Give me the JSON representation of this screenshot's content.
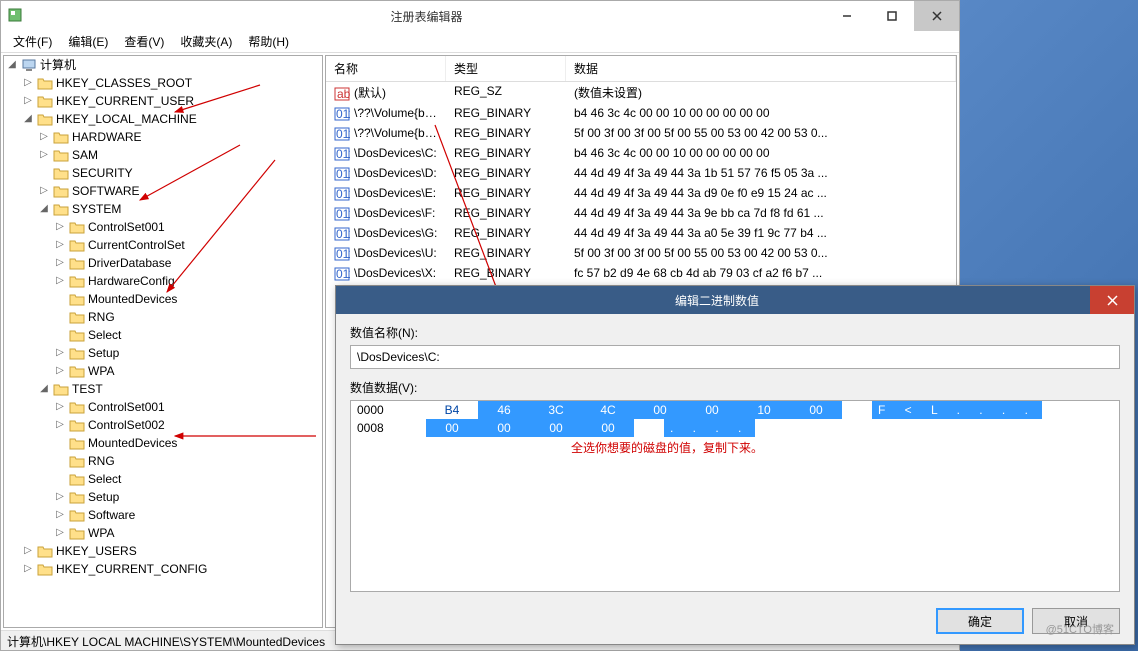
{
  "window": {
    "title": "注册表编辑器",
    "menus": [
      "文件(F)",
      "编辑(E)",
      "查看(V)",
      "收藏夹(A)",
      "帮助(H)"
    ],
    "status": "计算机\\HKEY LOCAL MACHINE\\SYSTEM\\MountedDevices"
  },
  "tree": {
    "root": "计算机",
    "hives": [
      {
        "name": "HKEY_CLASSES_ROOT",
        "exp": "▷"
      },
      {
        "name": "HKEY_CURRENT_USER",
        "exp": "▷"
      },
      {
        "name": "HKEY_LOCAL_MACHINE",
        "exp": "◢",
        "children": [
          {
            "name": "HARDWARE",
            "exp": "▷"
          },
          {
            "name": "SAM",
            "exp": "▷"
          },
          {
            "name": "SECURITY",
            "exp": ""
          },
          {
            "name": "SOFTWARE",
            "exp": "▷"
          },
          {
            "name": "SYSTEM",
            "exp": "◢",
            "children": [
              {
                "name": "ControlSet001",
                "exp": "▷"
              },
              {
                "name": "CurrentControlSet",
                "exp": "▷"
              },
              {
                "name": "DriverDatabase",
                "exp": "▷"
              },
              {
                "name": "HardwareConfig",
                "exp": "▷"
              },
              {
                "name": "MountedDevices",
                "exp": ""
              },
              {
                "name": "RNG",
                "exp": ""
              },
              {
                "name": "Select",
                "exp": ""
              },
              {
                "name": "Setup",
                "exp": "▷"
              },
              {
                "name": "WPA",
                "exp": "▷"
              }
            ]
          },
          {
            "name": "TEST",
            "exp": "◢",
            "children": [
              {
                "name": "ControlSet001",
                "exp": "▷"
              },
              {
                "name": "ControlSet002",
                "exp": "▷"
              },
              {
                "name": "MountedDevices",
                "exp": ""
              },
              {
                "name": "RNG",
                "exp": ""
              },
              {
                "name": "Select",
                "exp": ""
              },
              {
                "name": "Setup",
                "exp": "▷"
              },
              {
                "name": "Software",
                "exp": "▷"
              },
              {
                "name": "WPA",
                "exp": "▷"
              }
            ]
          }
        ]
      },
      {
        "name": "HKEY_USERS",
        "exp": "▷"
      },
      {
        "name": "HKEY_CURRENT_CONFIG",
        "exp": "▷"
      }
    ]
  },
  "list": {
    "headers": {
      "name": "名称",
      "type": "类型",
      "data": "数据"
    },
    "rows": [
      {
        "icon": "str",
        "name": "(默认)",
        "type": "REG_SZ",
        "data": "(数值未设置)"
      },
      {
        "icon": "bin",
        "name": "\\??\\Volume{bf...",
        "type": "REG_BINARY",
        "data": "b4 46 3c 4c 00 00 10 00 00 00 00 00"
      },
      {
        "icon": "bin",
        "name": "\\??\\Volume{bf...",
        "type": "REG_BINARY",
        "data": "5f 00 3f 00 3f 00 5f 00 55 00 53 00 42 00 53 0..."
      },
      {
        "icon": "bin",
        "name": "\\DosDevices\\C:",
        "type": "REG_BINARY",
        "data": "b4 46 3c 4c 00 00 10 00 00 00 00 00"
      },
      {
        "icon": "bin",
        "name": "\\DosDevices\\D:",
        "type": "REG_BINARY",
        "data": "44 4d 49 4f 3a 49 44 3a 1b 51 57 76 f5 05 3a ..."
      },
      {
        "icon": "bin",
        "name": "\\DosDevices\\E:",
        "type": "REG_BINARY",
        "data": "44 4d 49 4f 3a 49 44 3a d9 0e f0 e9 15 24 ac ..."
      },
      {
        "icon": "bin",
        "name": "\\DosDevices\\F:",
        "type": "REG_BINARY",
        "data": "44 4d 49 4f 3a 49 44 3a 9e bb ca 7d f8 fd 61 ..."
      },
      {
        "icon": "bin",
        "name": "\\DosDevices\\G:",
        "type": "REG_BINARY",
        "data": "44 4d 49 4f 3a 49 44 3a a0 5e 39 f1 9c 77 b4 ..."
      },
      {
        "icon": "bin",
        "name": "\\DosDevices\\U:",
        "type": "REG_BINARY",
        "data": "5f 00 3f 00 3f 00 5f 00 55 00 53 00 42 00 53 0..."
      },
      {
        "icon": "bin",
        "name": "\\DosDevices\\X:",
        "type": "REG_BINARY",
        "data": "fc 57 b2 d9 4e 68 cb 4d ab 79 03 cf a2 f6 b7 ..."
      }
    ]
  },
  "dialog": {
    "title": "编辑二进制数值",
    "name_label": "数值名称(N):",
    "name_value": "\\DosDevices\\C:",
    "data_label": "数值数据(V):",
    "hex_rows": [
      {
        "off": "0000",
        "bytes": [
          "B4",
          "46",
          "3C",
          "4C",
          "00",
          "00",
          "10",
          "00"
        ],
        "ascii": "F < L . . . ."
      },
      {
        "off": "0008",
        "bytes": [
          "00",
          "00",
          "00",
          "00"
        ],
        "ascii": ". . . ."
      }
    ],
    "note": "全选你想要的磁盘的值，复制下来。",
    "ok": "确定",
    "cancel": "取消"
  },
  "watermark": "@51CTO博客"
}
